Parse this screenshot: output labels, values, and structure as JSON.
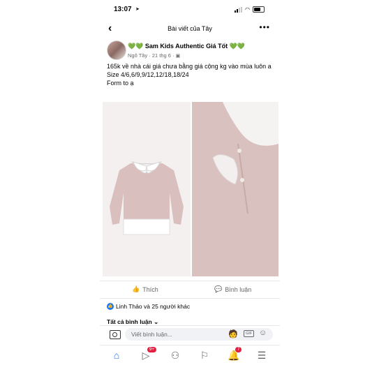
{
  "status": {
    "time": "13:07"
  },
  "nav": {
    "title": "Bài viết của Tây"
  },
  "post": {
    "author": "💚💚 Sam Kids Authentic Giá Tốt 💚💚",
    "meta": "Ngô Tây · 21 thg 6 · ",
    "lines": [
      "165k về nhà cái giá chưa bằng giá cộng kg vào mùa luôn a",
      "Size 4/6,6/9,9/12,12/18,18/24",
      "Form to ạ"
    ]
  },
  "actions": {
    "like_label": "Thích",
    "comment_label": "Bình luận"
  },
  "reactions": {
    "text": "Linh Thảo và 25 người khác"
  },
  "comments": {
    "all_label": "Tất cả bình luận",
    "placeholder": "Viết bình luận...",
    "gif_label": "GIF"
  },
  "tabbar": {
    "watch_badge": "9+",
    "notif_badge": "7"
  },
  "colors": {
    "accent": "#1877f2",
    "badge": "#e41e3f",
    "sweater": "#d8bebb"
  }
}
